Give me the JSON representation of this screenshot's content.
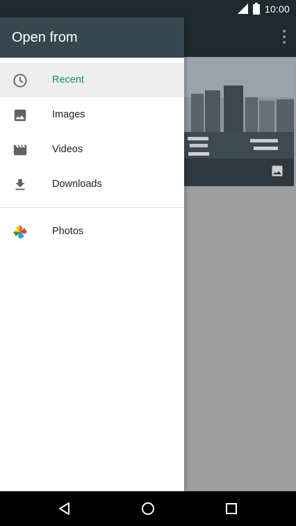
{
  "status_bar": {
    "time": "10:00"
  },
  "drawer": {
    "title": "Open from",
    "items": [
      {
        "label": "Recent",
        "icon": "clock-icon",
        "selected": true
      },
      {
        "label": "Images",
        "icon": "image-icon",
        "selected": false
      },
      {
        "label": "Videos",
        "icon": "video-icon",
        "selected": false
      },
      {
        "label": "Downloads",
        "icon": "download-icon",
        "selected": false
      }
    ],
    "apps": [
      {
        "label": "Photos",
        "icon": "google-photos-icon"
      }
    ]
  },
  "colors": {
    "header": "#37474f",
    "accent": "#11907f",
    "selected_bg": "#eeeeee",
    "status_bar": "#1f2a30"
  },
  "nav": {
    "buttons": [
      "back-icon",
      "home-icon",
      "recents-icon"
    ]
  }
}
